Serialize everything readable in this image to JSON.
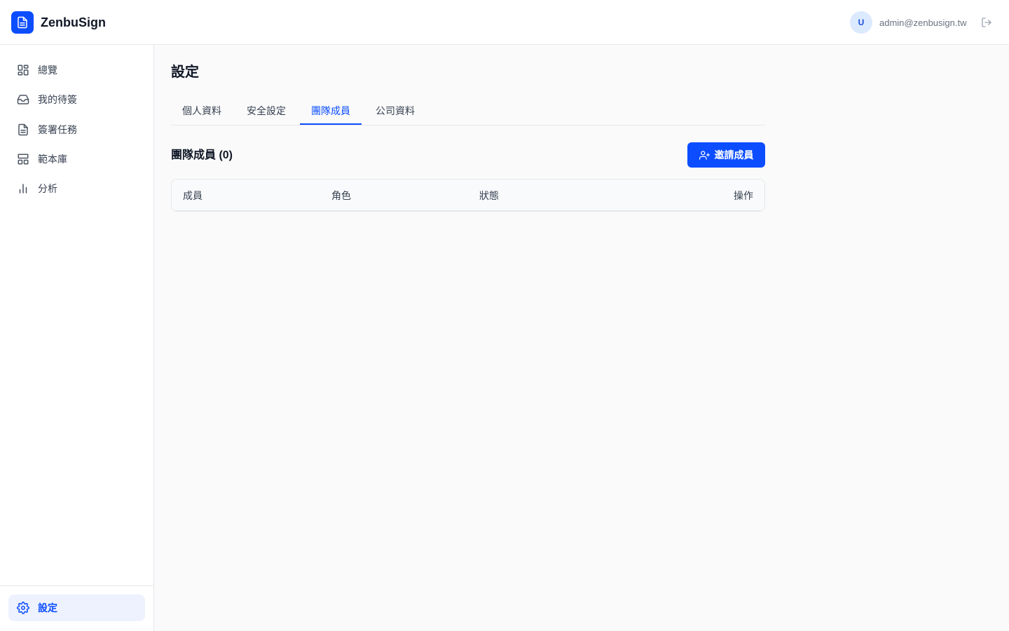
{
  "app": {
    "name": "ZenbuSign"
  },
  "user": {
    "avatar_initial": "U",
    "email": "admin@zenbusign.tw"
  },
  "sidebar": {
    "items": [
      {
        "label": "總覽",
        "icon": "dashboard-icon"
      },
      {
        "label": "我的待簽",
        "icon": "inbox-icon"
      },
      {
        "label": "簽署任務",
        "icon": "file-text-icon"
      },
      {
        "label": "範本庫",
        "icon": "template-icon"
      },
      {
        "label": "分析",
        "icon": "bar-chart-icon"
      }
    ],
    "settings_label": "設定"
  },
  "main": {
    "page_title": "設定",
    "tabs": [
      {
        "label": "個人資料",
        "active": false
      },
      {
        "label": "安全設定",
        "active": false
      },
      {
        "label": "團隊成員",
        "active": true
      },
      {
        "label": "公司資料",
        "active": false
      }
    ],
    "section_title": "團隊成員 (0)",
    "invite_button": "邀請成員",
    "table": {
      "columns": [
        "成員",
        "角色",
        "狀態",
        "操作"
      ],
      "rows": []
    }
  },
  "colors": {
    "accent": "#0b4dff",
    "avatar_bg": "#dbeafe",
    "active_nav_bg": "#eef2ff"
  }
}
